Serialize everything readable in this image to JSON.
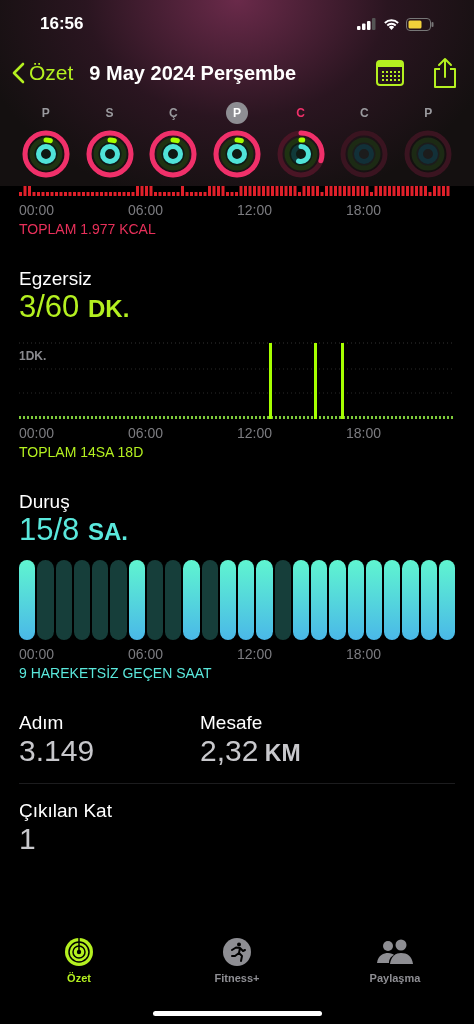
{
  "status_bar": {
    "time": "16:56"
  },
  "header": {
    "back_label": "Özet",
    "title": "9 May 2024 Perşembe"
  },
  "days": [
    {
      "label": "P",
      "selected": false,
      "today": false,
      "kind": "closed"
    },
    {
      "label": "S",
      "selected": false,
      "today": false,
      "kind": "closed"
    },
    {
      "label": "Ç",
      "selected": false,
      "today": false,
      "kind": "closed"
    },
    {
      "label": "P",
      "selected": true,
      "today": false,
      "kind": "closed"
    },
    {
      "label": "C",
      "selected": false,
      "today": true,
      "kind": "partial"
    },
    {
      "label": "C",
      "selected": false,
      "today": false,
      "kind": "future"
    },
    {
      "label": "P",
      "selected": false,
      "today": false,
      "kind": "future"
    }
  ],
  "move": {
    "ticks": [
      "00:00",
      "06:00",
      "12:00",
      "18:00"
    ],
    "total": "TOPLAM 1.977 KCAL"
  },
  "exercise": {
    "title": "Egzersiz",
    "value": "3/60",
    "unit": "DK.",
    "axis_label": "1DK.",
    "ticks": [
      "00:00",
      "06:00",
      "12:00",
      "18:00"
    ],
    "total": "TOPLAM 14SA 18D"
  },
  "stand": {
    "title": "Duruş",
    "value": "15/8",
    "unit": "SA.",
    "hours": [
      {
        "stood": true
      },
      {
        "stood": false
      },
      {
        "stood": false
      },
      {
        "stood": false
      },
      {
        "stood": false
      },
      {
        "stood": false
      },
      {
        "stood": true
      },
      {
        "stood": false
      },
      {
        "stood": false
      },
      {
        "stood": true
      },
      {
        "stood": false
      },
      {
        "stood": true
      },
      {
        "stood": true
      },
      {
        "stood": true
      },
      {
        "stood": false
      },
      {
        "stood": true
      },
      {
        "stood": true
      },
      {
        "stood": true
      },
      {
        "stood": true
      },
      {
        "stood": true
      },
      {
        "stood": true
      },
      {
        "stood": true
      },
      {
        "stood": true
      },
      {
        "stood": true
      }
    ],
    "ticks": [
      "00:00",
      "06:00",
      "12:00",
      "18:00"
    ],
    "total": "9 HAREKETSİZ GEÇEN SAAT"
  },
  "stats": [
    {
      "label": "Adım",
      "value": "3.149"
    },
    {
      "label": "Mesafe",
      "value": "2,32",
      "unit": "KM"
    }
  ],
  "floors": {
    "label": "Çıkılan Kat",
    "value": "1"
  },
  "tabs": [
    {
      "label": "Özet",
      "selected": true,
      "kind": "rings"
    },
    {
      "label": "Fitness+",
      "selected": false,
      "kind": "fitness"
    },
    {
      "label": "Paylaşma",
      "selected": false,
      "kind": "sharing"
    }
  ]
}
